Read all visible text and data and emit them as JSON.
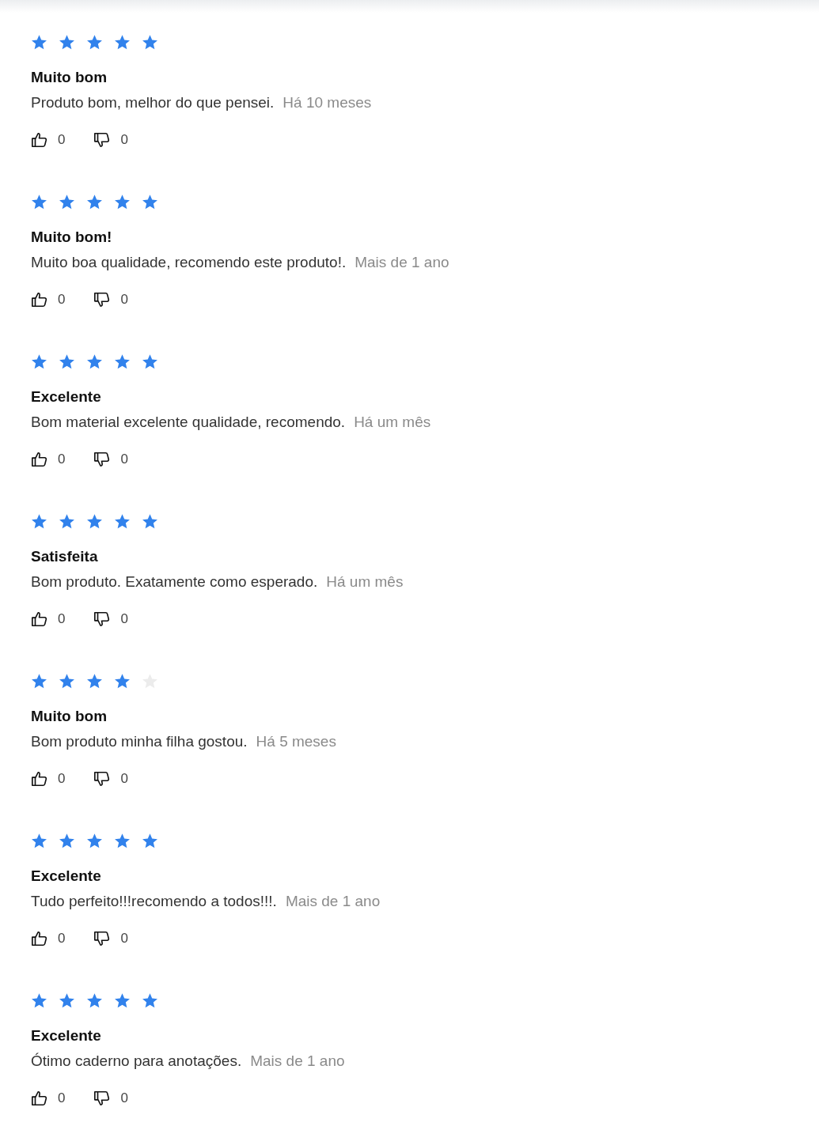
{
  "reviews": [
    {
      "stars": 5,
      "title": "Muito bom",
      "text": "Produto bom, melhor do que pensei.",
      "date": "Há 10 meses",
      "likes": "0",
      "dislikes": "0"
    },
    {
      "stars": 5,
      "title": "Muito bom!",
      "text": "Muito boa qualidade, recomendo este produto!.",
      "date": "Mais de 1 ano",
      "likes": "0",
      "dislikes": "0"
    },
    {
      "stars": 5,
      "title": "Excelente",
      "text": "Bom material excelente qualidade, recomendo.",
      "date": "Há um mês",
      "likes": "0",
      "dislikes": "0"
    },
    {
      "stars": 5,
      "title": "Satisfeita",
      "text": "Bom produto. Exatamente como esperado.",
      "date": "Há um mês",
      "likes": "0",
      "dislikes": "0"
    },
    {
      "stars": 4,
      "title": "Muito bom",
      "text": "Bom produto minha filha gostou.",
      "date": "Há 5 meses",
      "likes": "0",
      "dislikes": "0"
    },
    {
      "stars": 5,
      "title": "Excelente",
      "text": "Tudo perfeito!!!recomendo a todos!!!.",
      "date": "Mais de 1 ano",
      "likes": "0",
      "dislikes": "0"
    },
    {
      "stars": 5,
      "title": "Excelente",
      "text": "Ótimo caderno para anotações.",
      "date": "Mais de 1 ano",
      "likes": "0",
      "dislikes": "0"
    }
  ]
}
